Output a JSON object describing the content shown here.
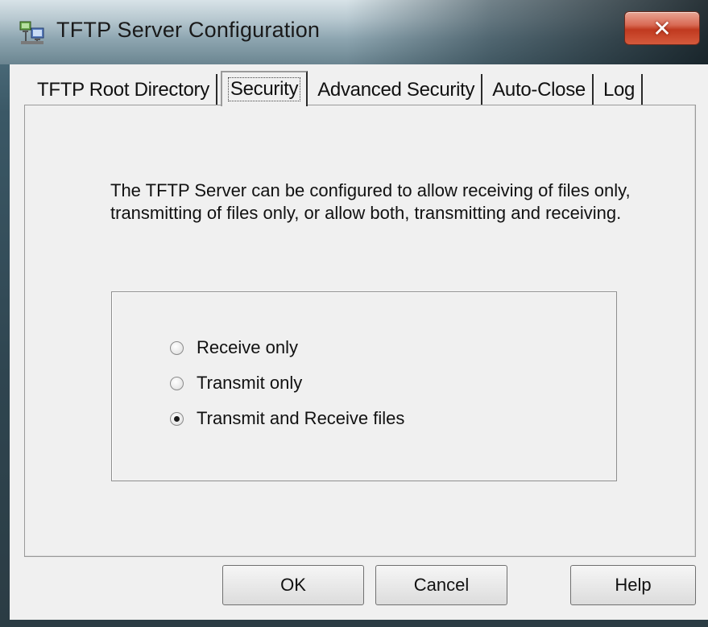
{
  "window": {
    "title": "TFTP Server Configuration",
    "close_glyph": "✕",
    "app_icon": "network-computers-icon"
  },
  "tabs": [
    {
      "label": "TFTP Root Directory",
      "active": false
    },
    {
      "label": "Security",
      "active": true
    },
    {
      "label": "Advanced Security",
      "active": false
    },
    {
      "label": "Auto-Close",
      "active": false
    },
    {
      "label": "Log",
      "active": false
    }
  ],
  "security": {
    "description": "The TFTP Server can be configured to allow receiving of files only, transmitting of files only, or allow both, transmitting and receiving.",
    "options": [
      {
        "label": "Receive only",
        "selected": false
      },
      {
        "label": "Transmit only",
        "selected": false
      },
      {
        "label": "Transmit and Receive files",
        "selected": true
      }
    ]
  },
  "buttons": {
    "ok": "OK",
    "cancel": "Cancel",
    "help": "Help"
  },
  "colors": {
    "dialog_background": "#f0f0f0",
    "close_button": "#c0391f"
  }
}
